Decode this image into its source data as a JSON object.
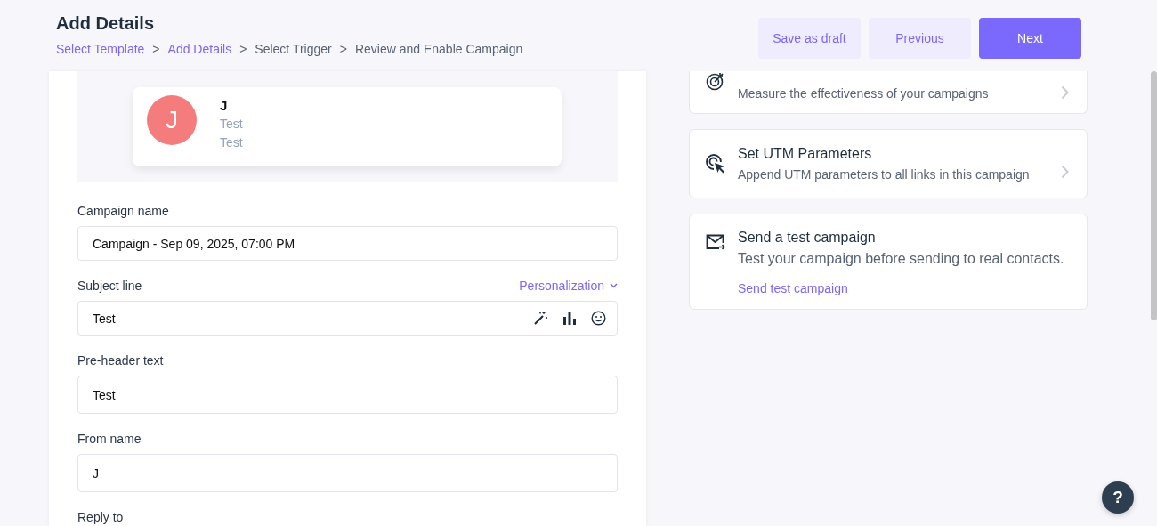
{
  "header": {
    "title": "Add Details",
    "breadcrumb": [
      {
        "label": "Select Template",
        "completed": true
      },
      {
        "label": "Add Details",
        "completed": true
      },
      {
        "label": "Select Trigger",
        "completed": false
      },
      {
        "label": "Review and Enable Campaign",
        "completed": false
      }
    ],
    "separator": ">",
    "buttons": [
      {
        "label": "Save as draft",
        "kind": "secondary"
      },
      {
        "label": "Previous",
        "kind": "secondary"
      },
      {
        "label": "Next",
        "kind": "primary"
      }
    ]
  },
  "preview": {
    "avatar_letter": "J",
    "sender": "J",
    "lines": [
      "Test",
      "Test"
    ]
  },
  "fields": [
    {
      "kind": "text",
      "label": "Campaign name",
      "value": "Campaign - Sep 09, 2025, 07:00 PM"
    },
    {
      "kind": "subject",
      "label": "Subject line",
      "value": "Test",
      "personalization": "Personalization"
    },
    {
      "kind": "text",
      "label": "Pre-header text",
      "value": "Test"
    },
    {
      "kind": "text",
      "label": "From name",
      "value": "J"
    },
    {
      "kind": "label",
      "label": "Reply to"
    }
  ],
  "side_cards": [
    {
      "kind": "goal",
      "description": "Measure the effectiveness of your campaigns"
    },
    {
      "kind": "utm",
      "title": "Set UTM Parameters",
      "description": "Append UTM parameters to all links in this campaign"
    },
    {
      "kind": "test",
      "title": "Send a test campaign",
      "description": "Test your campaign before sending to real contacts.",
      "link": "Send test campaign"
    }
  ],
  "help": {
    "label": "?"
  }
}
